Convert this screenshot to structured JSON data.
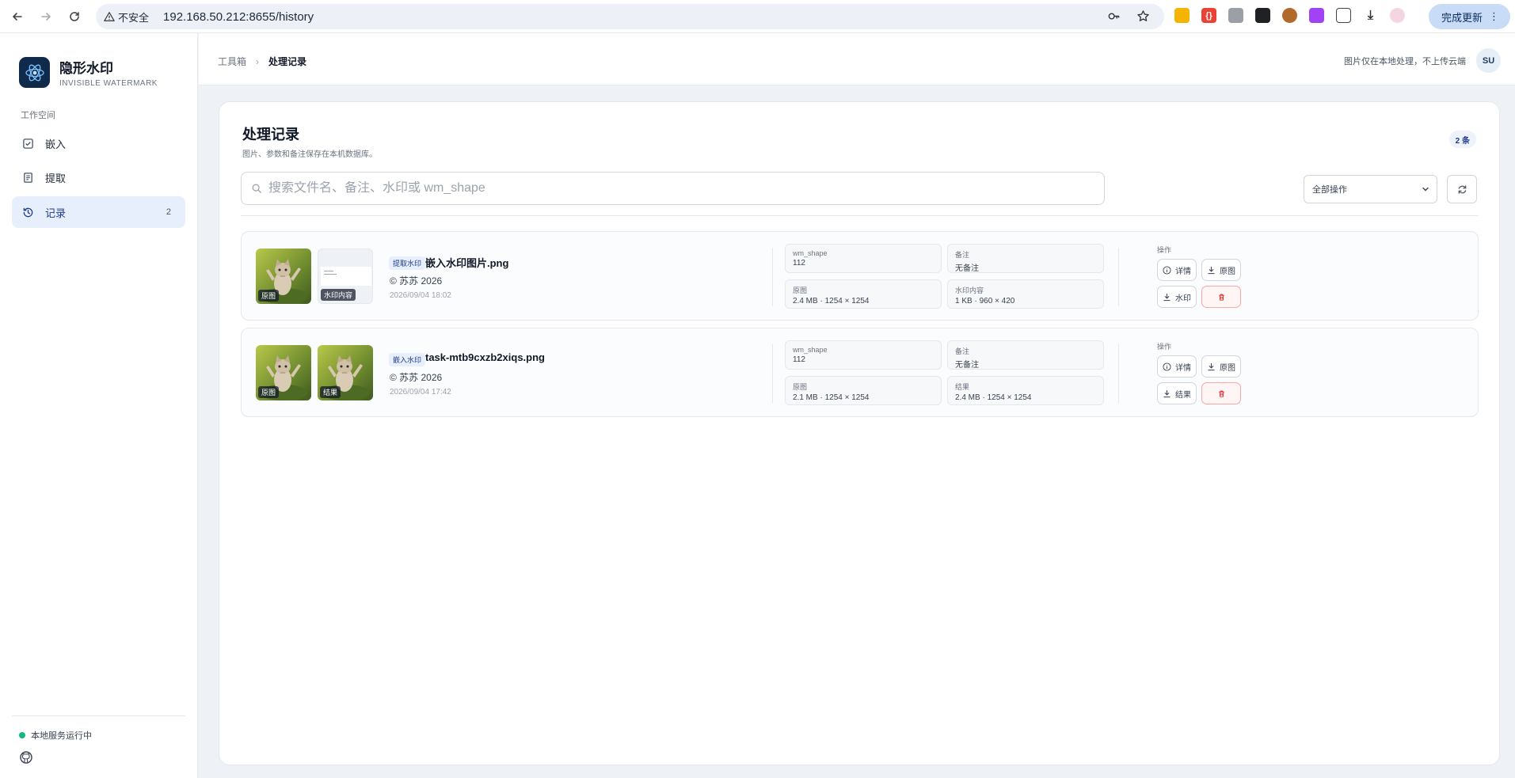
{
  "browser": {
    "security_label": "不安全",
    "url": "192.168.50.212:8655/history",
    "update_label": "完成更新"
  },
  "brand": {
    "title": "隐形水印",
    "subtitle": "INVISIBLE WATERMARK"
  },
  "sidebar": {
    "section_label": "工作空间",
    "items": [
      {
        "label": "嵌入",
        "icon": "checkbox-icon"
      },
      {
        "label": "提取",
        "icon": "document-icon"
      },
      {
        "label": "记录",
        "icon": "history-icon",
        "count": "2",
        "active": true
      }
    ],
    "status": "本地服务运行中"
  },
  "header": {
    "breadcrumb_root": "工具箱",
    "breadcrumb_current": "处理记录",
    "privacy_note": "图片仅在本地处理，不上传云端",
    "avatar_initials": "SU"
  },
  "page": {
    "title": "处理记录",
    "subtitle": "图片、参数和备注保存在本机数据库。",
    "count_badge": "2 条",
    "search_placeholder": "搜索文件名、备注、水印或 wm_shape",
    "filter_value": "全部操作"
  },
  "records": [
    {
      "type": "提取水印",
      "filename": "嵌入水印图片.png",
      "watermark": "© 苏苏 2026",
      "time": "2026/09/04 18:02",
      "thumb1_label": "原图",
      "thumb2_label": "水印内容",
      "meta": [
        {
          "key": "wm_shape",
          "value": "112"
        },
        {
          "key": "备注",
          "value": "无备注"
        },
        {
          "key": "原图",
          "value": "2.4 MB · 1254 × 1254"
        },
        {
          "key": "水印内容",
          "value": "1 KB · 960 × 420"
        }
      ],
      "ops_label": "操作",
      "btn_detail": "详情",
      "btn_original": "原图",
      "btn_third": "水印"
    },
    {
      "type": "嵌入水印",
      "filename": "task-mtb9cxzb2xiqs.png",
      "watermark": "© 苏苏 2026",
      "time": "2026/09/04 17:42",
      "thumb1_label": "原图",
      "thumb2_label": "结果",
      "meta": [
        {
          "key": "wm_shape",
          "value": "112"
        },
        {
          "key": "备注",
          "value": "无备注"
        },
        {
          "key": "原图",
          "value": "2.1 MB · 1254 × 1254"
        },
        {
          "key": "结果",
          "value": "2.4 MB · 1254 × 1254"
        }
      ],
      "ops_label": "操作",
      "btn_detail": "详情",
      "btn_original": "原图",
      "btn_third": "结果"
    }
  ],
  "colors": {
    "accent": "#1e3a8a",
    "active_bg": "#e8effc",
    "status_green": "#10b981",
    "danger": "#dc2626"
  }
}
